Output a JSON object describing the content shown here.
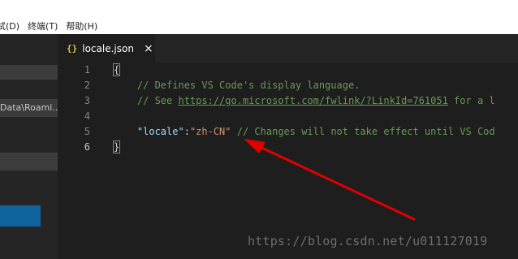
{
  "menubar": {
    "items": [
      "试(D)",
      "终端(T)",
      "帮助(H)"
    ]
  },
  "sidebar": {
    "path_text": "Data\\Roami..."
  },
  "tab": {
    "icon": "{}",
    "filename": "locale.json",
    "close": "×"
  },
  "editor": {
    "line_numbers": [
      "1",
      "2",
      "3",
      "4",
      "5",
      "6"
    ],
    "line1": "{",
    "line2_comment": "// Defines VS Code's display language.",
    "line3_prefix": "// See ",
    "line3_link": "https://go.microsoft.com/fwlink/?LinkId=761051",
    "line3_suffix": " for a l",
    "line5_key": "\"locale\"",
    "line5_colon": ":",
    "line5_value": "\"zh-CN\"",
    "line5_comment": " // Changes will not take effect until VS Cod",
    "line6": "}"
  },
  "watermark": "https://blog.csdn.net/u011127019",
  "colors": {
    "editor_bg": "#1e1e1e",
    "comment": "#6a9955",
    "json_key": "#9cdcfe",
    "json_string": "#ce9178",
    "arrow": "#e00000",
    "accent_blue": "#0e639c"
  }
}
